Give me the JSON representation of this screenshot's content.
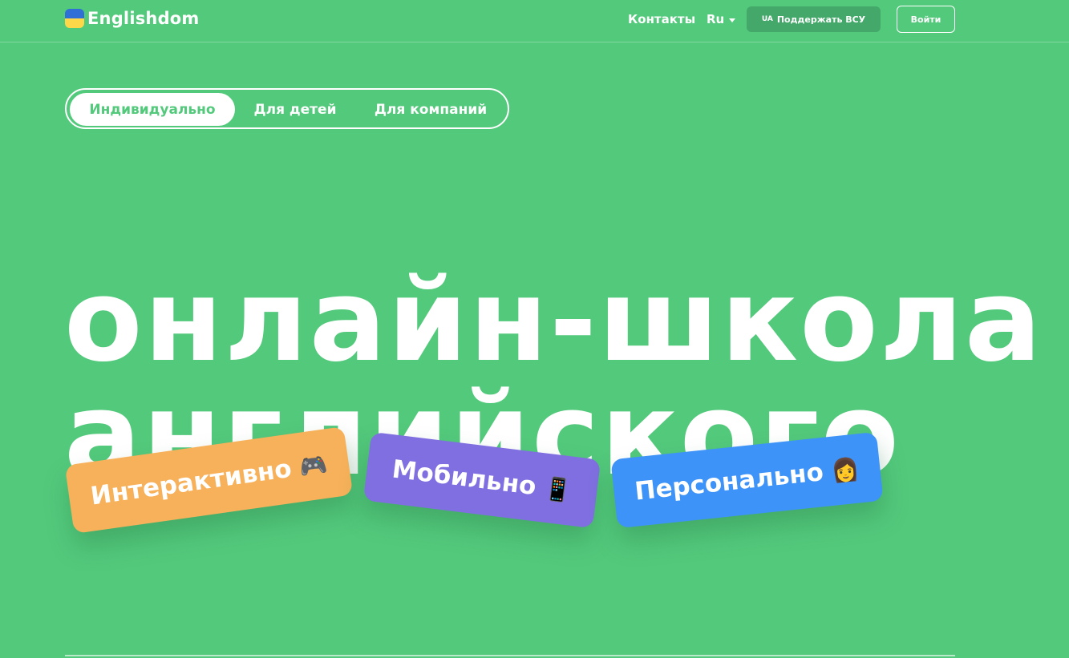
{
  "colors": {
    "background": "#53c97c",
    "flag_blue": "#2f6fd6",
    "flag_yellow": "#ffd84a",
    "support_button": "#43a86a",
    "card_interactive": "#f7b15a",
    "card_mobile": "#7f6fe0",
    "card_personal": "#3d93f7"
  },
  "header": {
    "logo_text": "Englishdom",
    "nav_contacts": "Контакты",
    "language": "Ru",
    "support_button": {
      "prefix": "UA",
      "label": "Поддержать ВСУ"
    },
    "login_button": "Войти"
  },
  "tabs": [
    {
      "label": "Индивидуально",
      "active": true
    },
    {
      "label": "Для детей",
      "active": false
    },
    {
      "label": "Для компаний",
      "active": false
    }
  ],
  "hero": {
    "line1": "онлайн-школа",
    "line2": "английского"
  },
  "cards": [
    {
      "label": "Интерактивно",
      "emoji": "🎮",
      "icon": "gamepad-icon"
    },
    {
      "label": "Мобильно",
      "emoji": "📱",
      "icon": "phone-icon"
    },
    {
      "label": "Персонально",
      "emoji": "👩",
      "icon": "person-icon"
    }
  ]
}
